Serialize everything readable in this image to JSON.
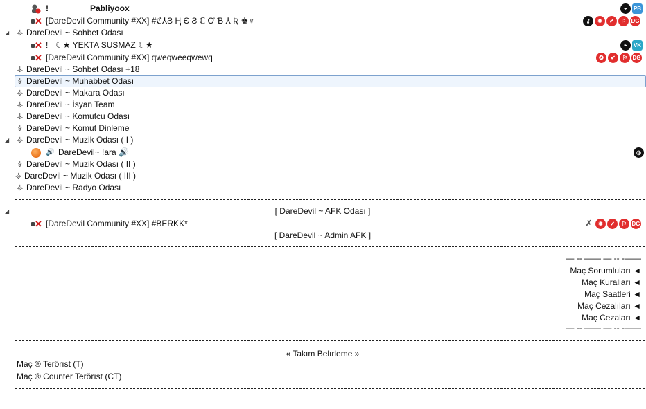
{
  "tree": {
    "top_user": {
      "name": "Pabliyoox",
      "prefix": "!",
      "badges": [
        "PB"
      ]
    },
    "server_user": {
      "name": "[DareDevil Community #XX] #ℭ⅄Ƨ Ⱨ Є Ƨ ℂ Ơ Ɓ ⅄ Ʀ ♚♆",
      "badges": [
        "key",
        "✔",
        "✔",
        "⚐",
        "DG"
      ]
    },
    "channels": [
      {
        "id": "sohbet",
        "label": "DareDevil ~ Sohbet Odası"
      },
      {
        "id": "sohbet18",
        "label": "DareDevil ~ Sohbet Odası +18"
      },
      {
        "id": "muhabbet",
        "label": "DareDevil ~ Muhabbet Odası"
      },
      {
        "id": "makara",
        "label": "DareDevil ~ Makara Odası"
      },
      {
        "id": "isyan",
        "label": "DareDevil ~ İsyan Team"
      },
      {
        "id": "komutcu",
        "label": "DareDevil ~ Komutcu Odası"
      },
      {
        "id": "komut",
        "label": "DareDevil ~ Komut Dinleme"
      },
      {
        "id": "muzik1",
        "label": "DareDevil ~ Muzik Odası ( I )"
      },
      {
        "id": "muzik2",
        "label": "DareDevil ~ Muzik Odası ( II )"
      },
      {
        "id": "muzik3",
        "label": "DareDevil ~ Muzik Odası ( III )"
      },
      {
        "id": "radyo",
        "label": "DareDevil ~ Radyo Odası"
      }
    ],
    "sohbet_users": [
      {
        "prefix": "!",
        "name": "☾★      YEKTA SUSMAZ    ☾★"
      },
      {
        "prefix": "",
        "name": "[DareDevil Community #XX] qweqweeqwewq"
      }
    ],
    "muzik_user": {
      "name": "DareDevil~ !ara 🔊"
    },
    "afk_title": "[ DareDevil ~ AFK Odası ]",
    "afk_user": {
      "name": "[DareDevil Community #XX] #BERKK*"
    },
    "admin_afk": "[ DareDevil ~ Admin AFK ]",
    "mac_lines": "— -- —— — -- -——",
    "mac_items": [
      "Maç Sorumluları ◄",
      "Maç Kuralları ◄",
      "Maç Saatleri ◄",
      "Maç Cezalıları ◄",
      "Maç Cezaları ◄"
    ],
    "takim": "« Takım Belırleme »",
    "team_t": "Maç ® Terörıst (T)",
    "team_ct": "Maç ® Counter Terörıst (CT)"
  },
  "colors": {
    "badge_red": "#e12e2e",
    "badge_black": "#111111",
    "selection": "#eef5fd"
  }
}
